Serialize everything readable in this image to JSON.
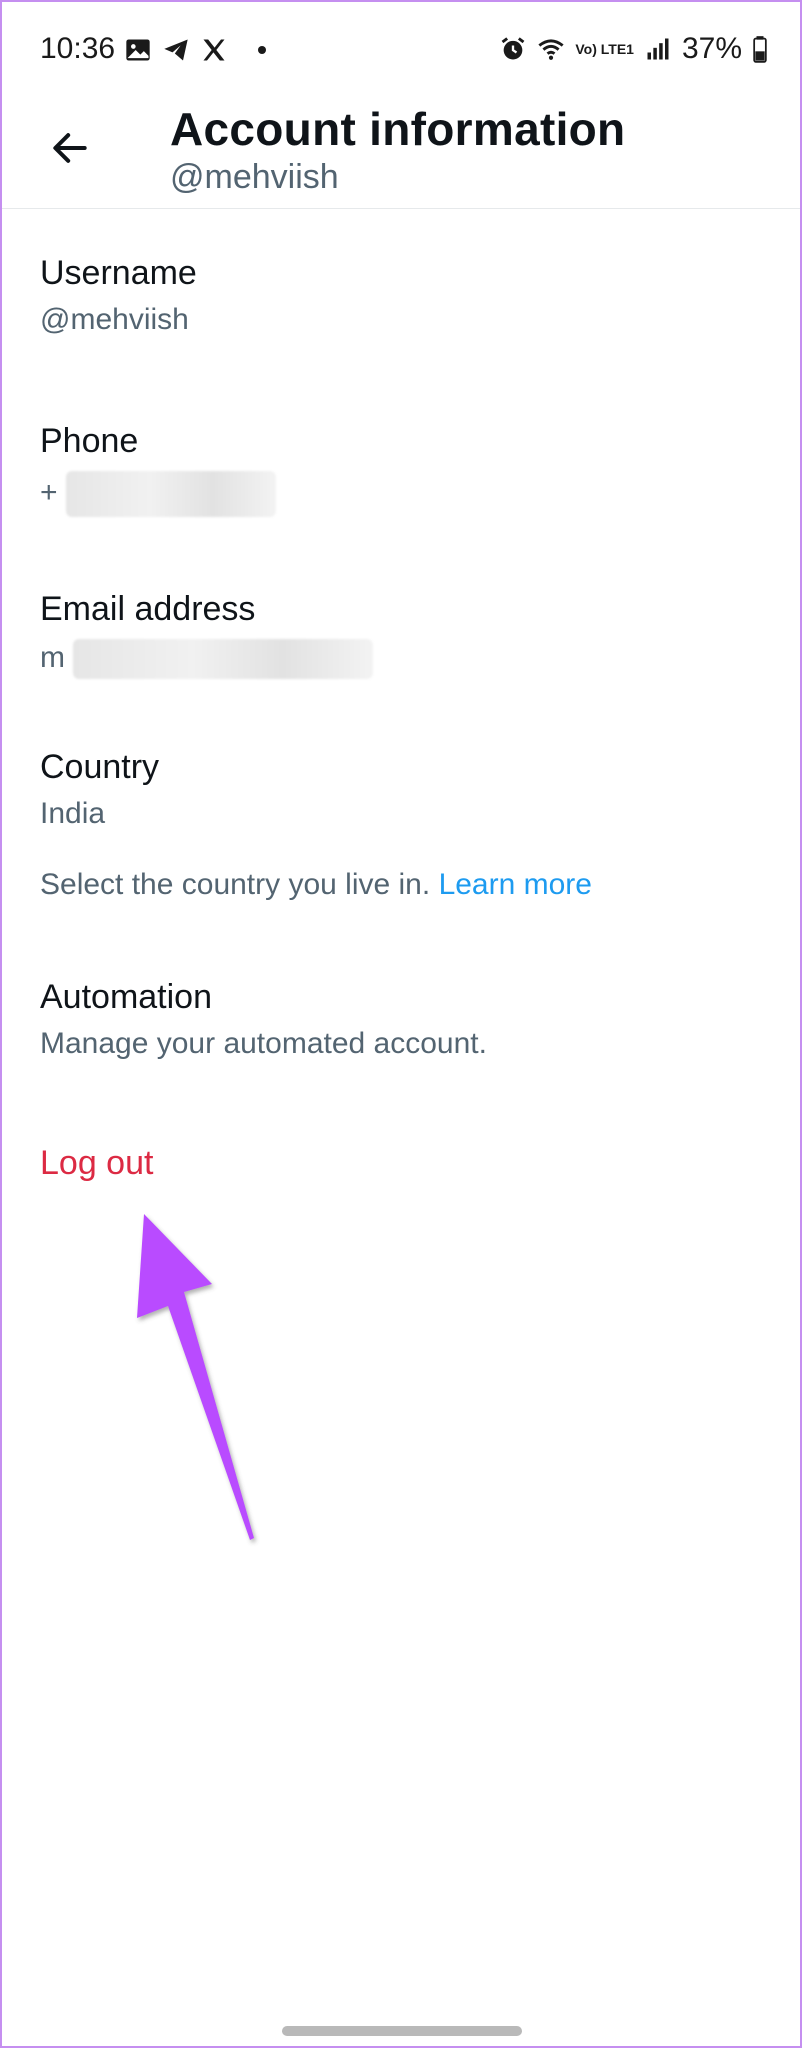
{
  "status_bar": {
    "time": "10:36",
    "network_label": "Vo) LTE1",
    "battery": "37%"
  },
  "header": {
    "title": "Account information",
    "subtitle": "@mehviish"
  },
  "rows": {
    "username": {
      "label": "Username",
      "value": "@mehviish"
    },
    "phone": {
      "label": "Phone",
      "value_prefix": "+"
    },
    "email": {
      "label": "Email address",
      "value_prefix": "m"
    },
    "country": {
      "label": "Country",
      "value": "India"
    },
    "country_hint": {
      "text": "Select the country you live in.",
      "link": "Learn more"
    },
    "automation": {
      "label": "Automation",
      "value": "Manage your automated account."
    }
  },
  "logout": {
    "label": "Log out"
  },
  "colors": {
    "danger": "#dc2a43",
    "link": "#1d9bf0",
    "secondary_text": "#536471",
    "annotation": "#b94cff"
  },
  "icons": {
    "back": "arrow-left-icon",
    "gallery": "image-icon",
    "telegram": "telegram-icon",
    "x": "x-logo-icon",
    "alarm": "alarm-icon",
    "wifi": "wifi-icon",
    "signal": "signal-icon",
    "battery": "battery-icon"
  }
}
